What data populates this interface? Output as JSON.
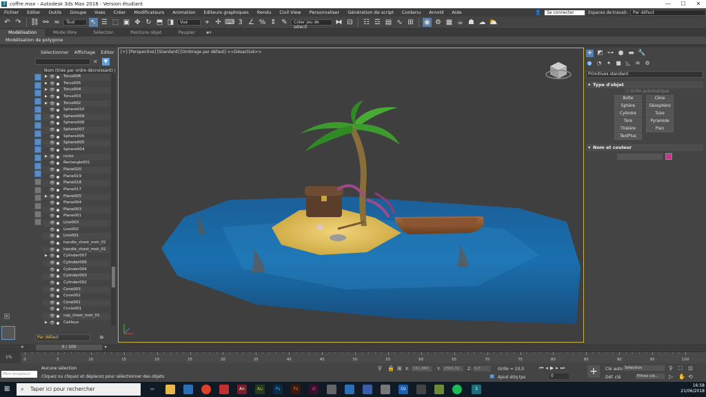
{
  "window": {
    "title": "coffre.max - Autodesk 3ds Max 2018 - Version étudiant",
    "app_icon": "3"
  },
  "menu": [
    "Fichier",
    "Editer",
    "Outils",
    "Groupe",
    "Vues",
    "Créer",
    "Modificateurs",
    "Animation",
    "Editeurs graphiques",
    "Rendu",
    "Civil View",
    "Personnaliser",
    "Génération de script",
    "Contenu",
    "Arnold",
    "Aide"
  ],
  "account": {
    "signin": "Se connecter",
    "workspace_label": "Espaces de travail:",
    "workspace_value": "Par défaut"
  },
  "toolbar": {
    "selection_filter": "Tout",
    "reference_coord": "Vue",
    "named_selection": "Créer jeu de sélecti"
  },
  "ribbon": {
    "tabs": [
      "Modélisation",
      "Mode libre",
      "Sélection",
      "Peinture objet",
      "Peupler"
    ],
    "active_tab": "Modélisation",
    "subpanel": "Modélisation de polygone"
  },
  "explorer": {
    "tabs": [
      "Sélectionner",
      "Affichage",
      "Editer"
    ],
    "column_header": "Nom (triés par ordre décroissant)",
    "column_header_extra": "Ge",
    "items": [
      {
        "name": "Torus006",
        "arrow": true
      },
      {
        "name": "Torus005",
        "arrow": true
      },
      {
        "name": "Torus004",
        "arrow": true
      },
      {
        "name": "Torus003",
        "arrow": true
      },
      {
        "name": "Torus002",
        "arrow": true
      },
      {
        "name": "Sphere010",
        "arrow": false
      },
      {
        "name": "Sphere009",
        "arrow": false
      },
      {
        "name": "Sphere008",
        "arrow": false
      },
      {
        "name": "Sphere007",
        "arrow": false
      },
      {
        "name": "Sphere006",
        "arrow": false
      },
      {
        "name": "Sphere005",
        "arrow": false
      },
      {
        "name": "Sphere004",
        "arrow": false
      },
      {
        "name": "rocks",
        "arrow": true
      },
      {
        "name": "Rectangle001",
        "arrow": false
      },
      {
        "name": "Plane020",
        "arrow": false
      },
      {
        "name": "Plane019",
        "arrow": false
      },
      {
        "name": "Plane018",
        "arrow": false
      },
      {
        "name": "Plane017",
        "arrow": false
      },
      {
        "name": "Plane005",
        "arrow": true
      },
      {
        "name": "Plane004",
        "arrow": false
      },
      {
        "name": "Plane003",
        "arrow": false
      },
      {
        "name": "Plane001",
        "arrow": false
      },
      {
        "name": "Line003",
        "arrow": false
      },
      {
        "name": "Line002",
        "arrow": false
      },
      {
        "name": "Line001",
        "arrow": false
      },
      {
        "name": "handle_chest_msh_02",
        "arrow": false
      },
      {
        "name": "handle_chest_msh_01",
        "arrow": false
      },
      {
        "name": "Cylinder007",
        "arrow": true
      },
      {
        "name": "Cylinder005",
        "arrow": false
      },
      {
        "name": "Cylinder004",
        "arrow": false
      },
      {
        "name": "Cylinder003",
        "arrow": false
      },
      {
        "name": "Cylinder002",
        "arrow": false
      },
      {
        "name": "Cone003",
        "arrow": false
      },
      {
        "name": "Cone002",
        "arrow": false
      },
      {
        "name": "Cone001",
        "arrow": false
      },
      {
        "name": "Circle001",
        "arrow": false
      },
      {
        "name": "cap_chest_msh_01",
        "arrow": false
      },
      {
        "name": "Cailloux",
        "arrow": true
      }
    ],
    "layer": "Par défaut"
  },
  "viewport": {
    "label": "[+] [Perspective] [Standard] [Ombrage par défaut]  <<Désactivé>>"
  },
  "command_panel": {
    "category": "Primitives standard",
    "rollout_object_type": "Type d'objet",
    "autogrid": "Grille automatique",
    "object_buttons": [
      "Boîte",
      "Cône",
      "Sphère",
      "Géosphère",
      "Cylindre",
      "Tube",
      "Tore",
      "Pyramide",
      "Théière",
      "Plan",
      "TextPlus"
    ],
    "rollout_name_color": "Nom et couleur",
    "object_color": "#c23b8a"
  },
  "timeline": {
    "slider": "0 / 100",
    "ticks": [
      0,
      5,
      10,
      15,
      20,
      25,
      30,
      35,
      40,
      45,
      50,
      55,
      60,
      65,
      70,
      75,
      80,
      85,
      90,
      95,
      100
    ]
  },
  "status": {
    "maxscript_placeholder": "Mini-récepteur",
    "line1": "Aucune sélection",
    "line2": "Cliquez ou cliquez et déplacez pour sélectionner des objets",
    "x_label": "X:",
    "x_value": "161,888",
    "y_label": "Y:",
    "y_value": "2361,02",
    "z_label": "Z:",
    "z_value": "0,0",
    "grid": "Grille = 10,0",
    "add_tag": "Ajout étiq tps",
    "frame": "0",
    "autokey": "Clé auto",
    "setkey": "Déf. clé",
    "selection_mode": "Sélection",
    "key_filters": "Filtres clé..."
  },
  "taskbar": {
    "search_placeholder": "Taper ici pour rechercher",
    "time": "16:58",
    "date": "21/06/2018"
  }
}
